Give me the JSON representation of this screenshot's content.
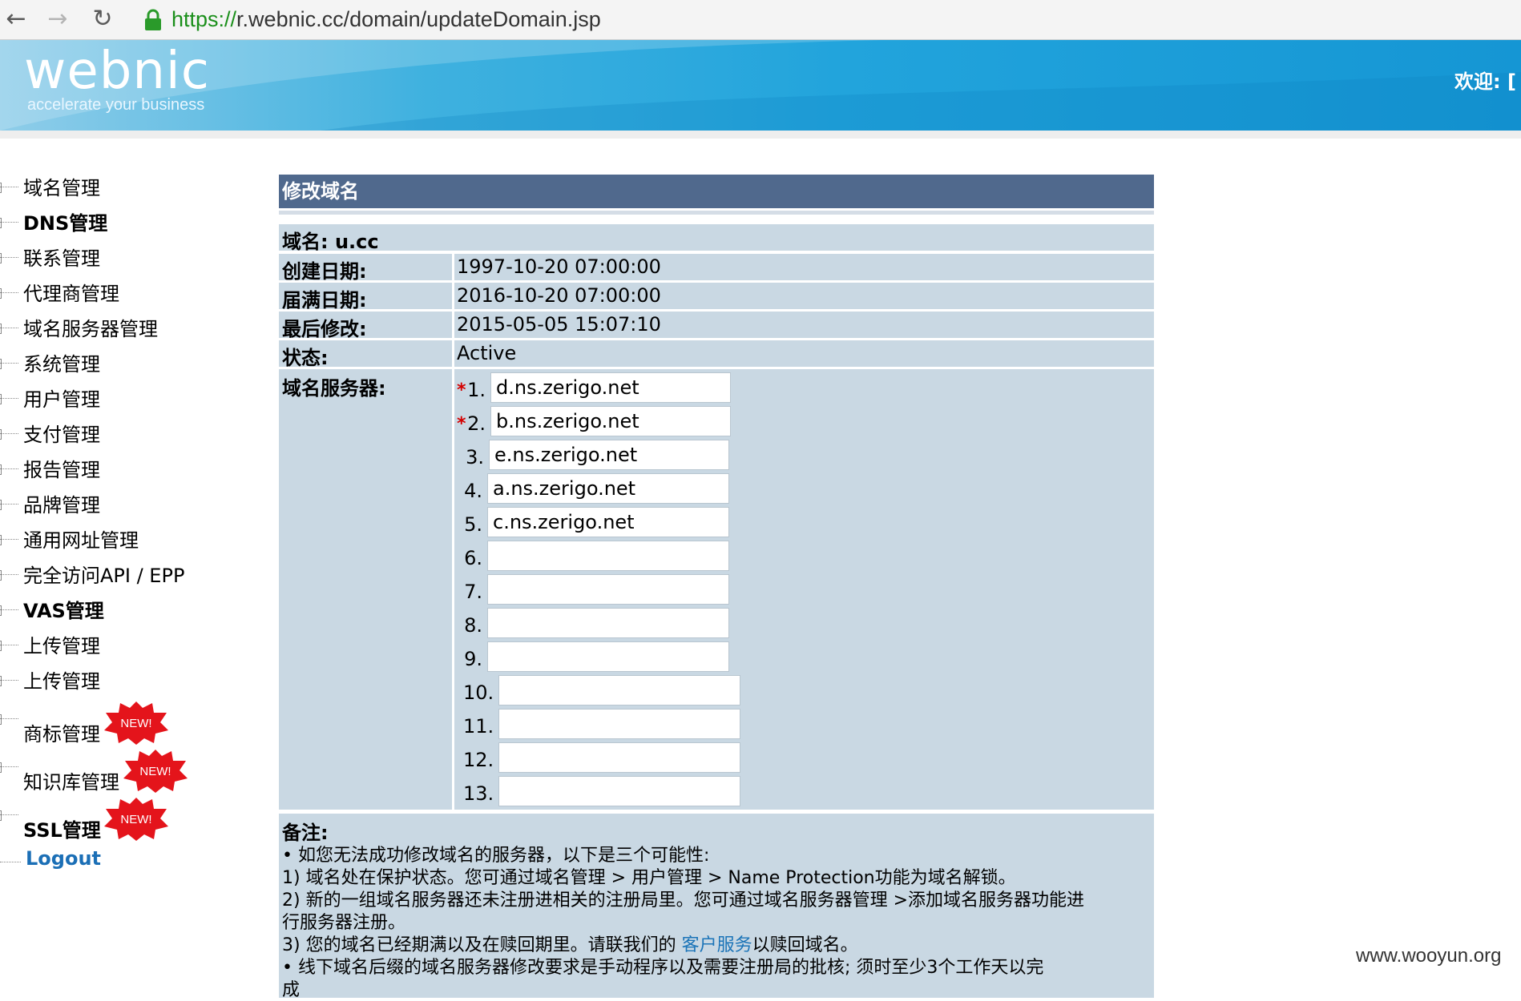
{
  "browser": {
    "url_scheme": "https://",
    "url_rest": "r.webnic.cc/domain/updateDomain.jsp"
  },
  "header": {
    "logo": "webnic",
    "tagline": "accelerate your business",
    "welcome": "欢迎: [ W"
  },
  "sidebar": {
    "items": [
      {
        "label": "域名管理"
      },
      {
        "label": "DNS管理"
      },
      {
        "label": "联系管理"
      },
      {
        "label": "代理商管理"
      },
      {
        "label": "域名服务器管理"
      },
      {
        "label": "系统管理"
      },
      {
        "label": "用户管理"
      },
      {
        "label": "支付管理"
      },
      {
        "label": "报告管理"
      },
      {
        "label": "品牌管理"
      },
      {
        "label": "通用网址管理"
      },
      {
        "label": "完全访问API / EPP"
      },
      {
        "label": "VAS管理"
      },
      {
        "label": "上传管理"
      },
      {
        "label": "上传管理"
      },
      {
        "label": "商标管理"
      },
      {
        "label": "知识库管理"
      },
      {
        "label": "SSL管理"
      }
    ],
    "new_badge": "NEW!",
    "logout": "Logout"
  },
  "panel": {
    "title": "修改域名",
    "domain_label": "域名: u.cc",
    "created_label": "创建日期:",
    "created_value": "1997-10-20 07:00:00",
    "expiry_label": "届满日期:",
    "expiry_value": "2016-10-20 07:00:00",
    "modified_label": "最后修改:",
    "modified_value": "2015-05-05 15:07:10",
    "status_label": "状态:",
    "status_value": "Active",
    "ns_label": "域名服务器:",
    "ns_required_mark": "*",
    "nameservers": [
      {
        "num": "1.",
        "value": "d.ns.zerigo.net"
      },
      {
        "num": "2.",
        "value": "b.ns.zerigo.net"
      },
      {
        "num": "3.",
        "value": "e.ns.zerigo.net"
      },
      {
        "num": "4.",
        "value": "a.ns.zerigo.net"
      },
      {
        "num": "5.",
        "value": "c.ns.zerigo.net"
      },
      {
        "num": "6.",
        "value": ""
      },
      {
        "num": "7.",
        "value": ""
      },
      {
        "num": "8.",
        "value": ""
      },
      {
        "num": "9.",
        "value": ""
      },
      {
        "num": "10.",
        "value": ""
      },
      {
        "num": "11.",
        "value": ""
      },
      {
        "num": "12.",
        "value": ""
      },
      {
        "num": "13.",
        "value": ""
      }
    ]
  },
  "notes": {
    "heading": "备注:",
    "line1": "• 如您无法成功修改域名的服务器，以下是三个可能性:",
    "line2": "1) 域名处在保护状态。您可通过域名管理 > 用户管理 > Name Protection功能为域名解锁。",
    "line3": "2) 新的一组域名服务器还未注册进相关的注册局里。您可通过域名服务器管理 >添加域名服务器功能进",
    "line4": "行服务器注册。",
    "line5_pre": "3) 您的域名已经期满以及在赎回期里。请联我们的 ",
    "line5_link": "客户服务",
    "line5_post": "以赎回域名。",
    "line6": "• 线下域名后缀的域名服务器修改要求是手动程序以及需要注册局的批核; 须时至少3个工作天以完",
    "line7": "成"
  },
  "watermark": "www.wooyun.org"
}
